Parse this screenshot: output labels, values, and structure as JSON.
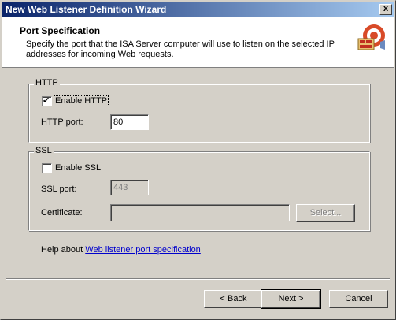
{
  "window": {
    "title": "New Web Listener Definition Wizard",
    "close_label": "x"
  },
  "header": {
    "title": "Port Specification",
    "description": "Specify the port that the ISA Server computer will use to listen on the selected IP addresses for incoming Web requests."
  },
  "http_group": {
    "legend": "HTTP",
    "enable_label": "Enable HTTP",
    "enable_checked": true,
    "port_label": "HTTP port:",
    "port_value": "80"
  },
  "ssl_group": {
    "legend": "SSL",
    "enable_label": "Enable SSL",
    "enable_checked": false,
    "port_label": "SSL port:",
    "port_value": "443",
    "certificate_label": "Certificate:",
    "certificate_value": "",
    "select_label": "Select..."
  },
  "help": {
    "prefix": "Help about ",
    "link_text": "Web listener port specification"
  },
  "buttons": {
    "back": "< Back",
    "next": "Next >",
    "cancel": "Cancel"
  },
  "colors": {
    "titlebar_start": "#0a246a",
    "titlebar_end": "#a6caf0",
    "link": "#0000cc",
    "face": "#d4d0c8"
  }
}
